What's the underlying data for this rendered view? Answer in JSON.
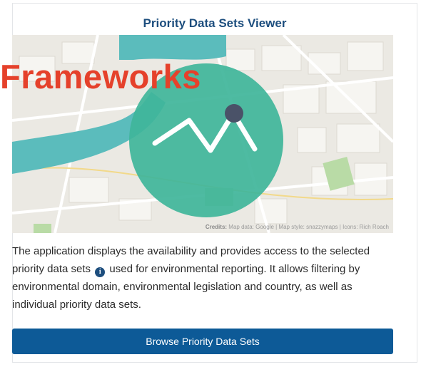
{
  "card": {
    "title": "Priority Data Sets Viewer"
  },
  "map": {
    "credits_label": "Credits:",
    "credits_text": "Map data: Google | Map style: snazzymaps | Icons: Rich Roach",
    "marker_icon": "line-chart-marker-icon"
  },
  "overlay": {
    "label": "Frameworks"
  },
  "description": {
    "text_before_icon": "The application displays the availability and provides access to the selected priority data sets",
    "info_icon_glyph": "i",
    "text_after_icon": "used for environmental reporting. It allows filtering by environmental domain, environmental legislation and country, as well as individual priority data sets."
  },
  "actions": {
    "browse_label": "Browse Priority Data Sets"
  },
  "colors": {
    "title": "#1d4e7e",
    "button": "#0d5a97",
    "overlay": "#e5412b",
    "water": "#5bbcbc",
    "accent_circle": "#3fb59a",
    "marker_dot": "#4a5268"
  }
}
